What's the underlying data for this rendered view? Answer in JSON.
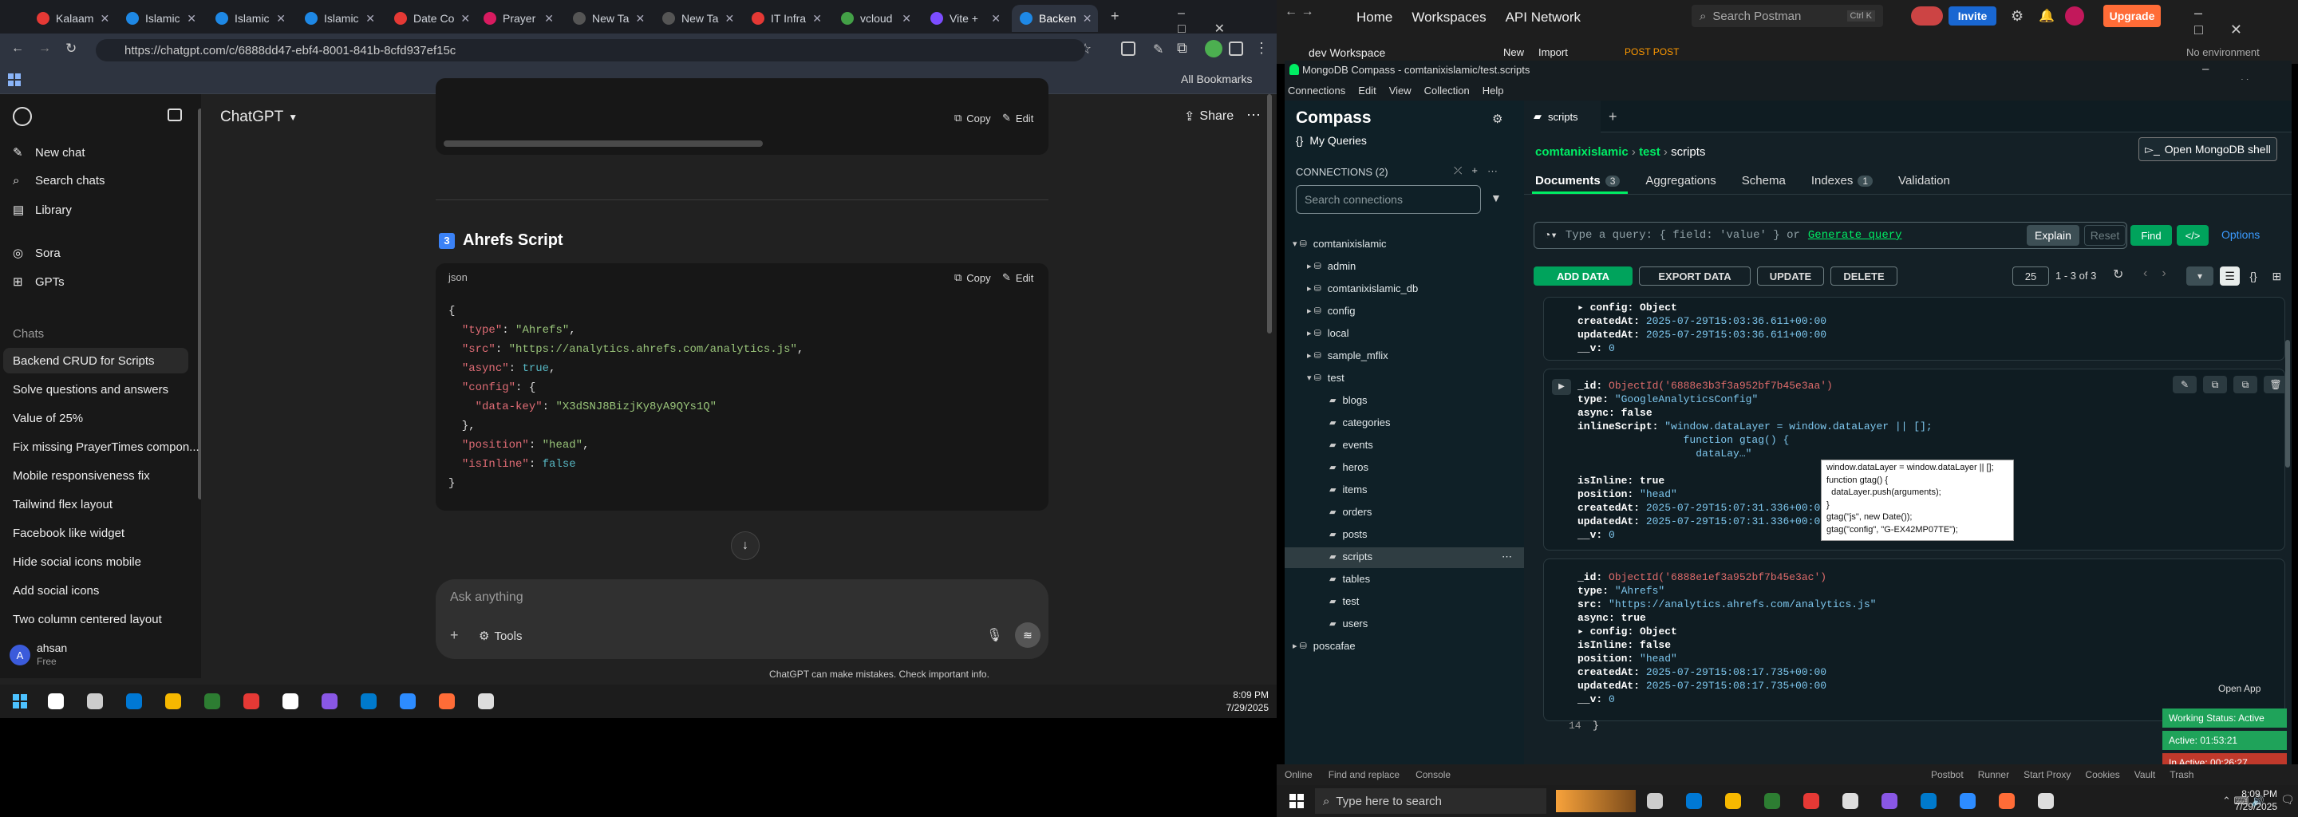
{
  "browser": {
    "tabs": [
      "Kalaam",
      "Islamic",
      "Islamic",
      "Islamic",
      "Date Co",
      "Prayer",
      "New Ta",
      "New Ta",
      "IT Infra",
      "vcloud",
      "Vite +",
      "Backen"
    ],
    "url": "https://chatgpt.com/c/6888dd47-ebf4-8001-841b-8cfd937ef15c",
    "all_bookmarks": "All Bookmarks"
  },
  "chatgpt": {
    "model_title": "ChatGPT",
    "share": "Share",
    "nav": [
      "New chat",
      "Search chats",
      "Library",
      "Sora",
      "GPTs"
    ],
    "chats_heading": "Chats",
    "chats": [
      "Backend CRUD for Scripts",
      "Solve questions and answers",
      "Value of 25%",
      "Fix missing PrayerTimes compon...",
      "Mobile responsiveness fix",
      "Tailwind flex layout",
      "Facebook like widget",
      "Hide social icons mobile",
      "Add social icons",
      "Two column centered layout"
    ],
    "user_name": "ahsan",
    "user_plan": "Free",
    "user_initial": "A",
    "copy": "Copy",
    "edit": "Edit",
    "section_number": "3",
    "section_title": "Ahrefs Script",
    "code_lang": "json",
    "code_lines": [
      [
        [
          "p",
          "{"
        ]
      ],
      [
        [
          "p",
          "  "
        ],
        [
          "k",
          "\"type\""
        ],
        [
          "p",
          ": "
        ],
        [
          "s",
          "\"Ahrefs\""
        ],
        [
          "p",
          ","
        ]
      ],
      [
        [
          "p",
          "  "
        ],
        [
          "k",
          "\"src\""
        ],
        [
          "p",
          ": "
        ],
        [
          "s",
          "\"https://analytics.ahrefs.com/analytics.js\""
        ],
        [
          "p",
          ","
        ]
      ],
      [
        [
          "p",
          "  "
        ],
        [
          "k",
          "\"async\""
        ],
        [
          "p",
          ": "
        ],
        [
          "b",
          "true"
        ],
        [
          "p",
          ","
        ]
      ],
      [
        [
          "p",
          "  "
        ],
        [
          "k",
          "\"config\""
        ],
        [
          "p",
          ": {"
        ]
      ],
      [
        [
          "p",
          "    "
        ],
        [
          "k",
          "\"data-key\""
        ],
        [
          "p",
          ": "
        ],
        [
          "s",
          "\"X3dSNJ8BizjKy8yA9QYs1Q\""
        ]
      ],
      [
        [
          "p",
          "  },"
        ]
      ],
      [
        [
          "p",
          "  "
        ],
        [
          "k",
          "\"position\""
        ],
        [
          "p",
          ": "
        ],
        [
          "s",
          "\"head\""
        ],
        [
          "p",
          ","
        ]
      ],
      [
        [
          "p",
          "  "
        ],
        [
          "k",
          "\"isInline\""
        ],
        [
          "p",
          ": "
        ],
        [
          "b",
          "false"
        ]
      ],
      [
        [
          "p",
          "}"
        ]
      ]
    ],
    "composer_placeholder": "Ask anything",
    "tools": "Tools",
    "disclaimer": "ChatGPT can make mistakes. Check important info."
  },
  "taskbar_left": {
    "time": "8:09 PM",
    "date": "7/29/2025"
  },
  "postman": {
    "nav": [
      "Home",
      "Workspaces",
      "API Network"
    ],
    "search": "Search Postman",
    "shortcut": "Ctrl K",
    "invite": "Invite",
    "upgrade": "Upgrade",
    "workspace": "dev Workspace",
    "new": "New",
    "import": "Import",
    "tab": "POST POST",
    "env": "No environment",
    "bottom": [
      "Online",
      "Find and replace",
      "Console"
    ],
    "bottom_right": [
      "Postbot",
      "Runner",
      "Start Proxy",
      "Cookies",
      "Vault",
      "Trash"
    ]
  },
  "compass": {
    "title": "MongoDB Compass - comtanixislamic/test.scripts",
    "menu": [
      "Connections",
      "Edit",
      "View",
      "Collection",
      "Help"
    ],
    "brand": "Compass",
    "my_queries": "My Queries",
    "connections_label": "CONNECTIONS (2)",
    "search_placeholder": "Search connections",
    "tree": {
      "conn1": "comtanixislamic",
      "dbs": [
        "admin",
        "comtanixislamic_db",
        "config",
        "local",
        "sample_mflix"
      ],
      "test_db": "test",
      "collections": [
        "blogs",
        "categories",
        "events",
        "heros",
        "items",
        "orders",
        "posts",
        "scripts",
        "tables",
        "test",
        "users"
      ],
      "conn2": "poscafae"
    },
    "tab": "scripts",
    "breadcrumb": [
      "comtanixislamic",
      "test",
      "scripts"
    ],
    "open_shell": "Open MongoDB shell",
    "subtabs": [
      {
        "label": "Documents",
        "count": "3"
      },
      {
        "label": "Aggregations"
      },
      {
        "label": "Schema"
      },
      {
        "label": "Indexes",
        "count": "1"
      },
      {
        "label": "Validation"
      }
    ],
    "query_placeholder": "Type a query: { field: 'value' } or",
    "generate_query": "Generate query",
    "explain": "Explain",
    "reset": "Reset",
    "find": "Find",
    "options": "Options",
    "add_data": "ADD DATA",
    "export_data": "EXPORT DATA",
    "update": "UPDATE",
    "delete": "DELETE",
    "page_size": "25",
    "range": "1 - 3 of 3",
    "doc1": [
      [
        "▸ config",
        ": ",
        "Object",
        "n"
      ],
      [
        "createdAt",
        ": ",
        "2025-07-29T15:03:36.611+00:00",
        "s"
      ],
      [
        "updatedAt",
        ": ",
        "2025-07-29T15:03:36.611+00:00",
        "s"
      ],
      [
        "__v",
        ": ",
        "0",
        "s"
      ]
    ],
    "doc2": [
      [
        "_id",
        ": ",
        "ObjectId('6888e3b3f3a952bf7b45e3aa')",
        "o"
      ],
      [
        "type",
        ": ",
        "\"GoogleAnalyticsConfig\"",
        "s"
      ],
      [
        "async",
        ": ",
        "false",
        "n"
      ],
      [
        "inlineScript",
        ": ",
        "\"window.dataLayer = window.dataLayer || [];",
        "s"
      ],
      [
        "",
        "",
        "                 function gtag() {",
        "s"
      ],
      [
        "",
        "",
        "                   dataLay…\"",
        "s"
      ],
      [
        "",
        "",
        "",
        ""
      ],
      [
        "isInline",
        ": ",
        "true",
        "n"
      ],
      [
        "position",
        ": ",
        "\"head\"",
        "s"
      ],
      [
        "createdAt",
        ": ",
        "2025-07-29T15:07:31.336+00:00",
        "s"
      ],
      [
        "updatedAt",
        ": ",
        "2025-07-29T15:07:31.336+00:00",
        "s"
      ],
      [
        "__v",
        ": ",
        "0",
        "s"
      ]
    ],
    "doc3": [
      [
        "_id",
        ": ",
        "ObjectId('6888e1ef3a952bf7b45e3ac')",
        "o"
      ],
      [
        "type",
        ": ",
        "\"Ahrefs\"",
        "s"
      ],
      [
        "src",
        ": ",
        "\"https://analytics.ahrefs.com/analytics.js\"",
        "s"
      ],
      [
        "async",
        ": ",
        "true",
        "n"
      ],
      [
        "▸ config",
        ": ",
        "Object",
        "n"
      ],
      [
        "isInline",
        ": ",
        "false",
        "n"
      ],
      [
        "position",
        ": ",
        "\"head\"",
        "s"
      ],
      [
        "createdAt",
        ": ",
        "2025-07-29T15:08:17.735+00:00",
        "s"
      ],
      [
        "updatedAt",
        ": ",
        "2025-07-29T15:08:17.735+00:00",
        "s"
      ],
      [
        "__v",
        ": ",
        "0",
        "s"
      ]
    ],
    "tooltip": [
      "window.dataLayer = window.dataLayer || [];",
      "function gtag() {",
      "  dataLayer.push(arguments);",
      "}",
      "gtag(\"js\", new Date());",
      "gtag(\"config\", \"G-EX42MP07TE\");"
    ],
    "line_no": "14",
    "brace": "}"
  },
  "widget": {
    "open_app": "Open App",
    "working": "Working Status: Active",
    "active": "Active: 01:53:21",
    "inactive": "In Active: 00:26:27"
  },
  "taskbar_right": {
    "search": "Type here to search",
    "time": "8:09 PM",
    "date": "7/29/2025"
  }
}
